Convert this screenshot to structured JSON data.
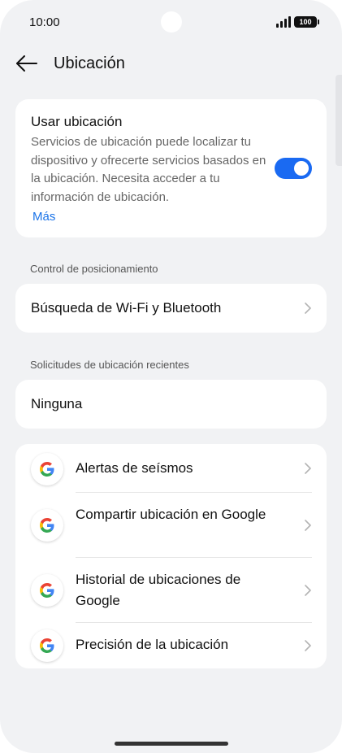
{
  "status": {
    "time": "10:00",
    "battery": "100"
  },
  "header": {
    "title": "Ubicación"
  },
  "use_location": {
    "title": "Usar ubicación",
    "description": "Servicios de ubicación puede localizar tu dispositivo y ofrecerte servicios basados en la ubicación. Necesita acceder a tu información de ubicación.",
    "more": "Más",
    "enabled": true
  },
  "positioning": {
    "label": "Control de posicionamiento",
    "wifi_bt": "Búsqueda de Wi-Fi y Bluetooth"
  },
  "recent": {
    "label": "Solicitudes de ubicación recientes",
    "none": "Ninguna"
  },
  "google_items": [
    {
      "label": "Alertas de seísmos"
    },
    {
      "label": "Compartir ubicación en Google"
    },
    {
      "label": "Historial de ubicaciones de Google"
    },
    {
      "label": "Precisión de la ubicación"
    }
  ],
  "colors": {
    "accent": "#1a6af2",
    "link": "#1a73e8",
    "background": "#f1f2f4"
  }
}
